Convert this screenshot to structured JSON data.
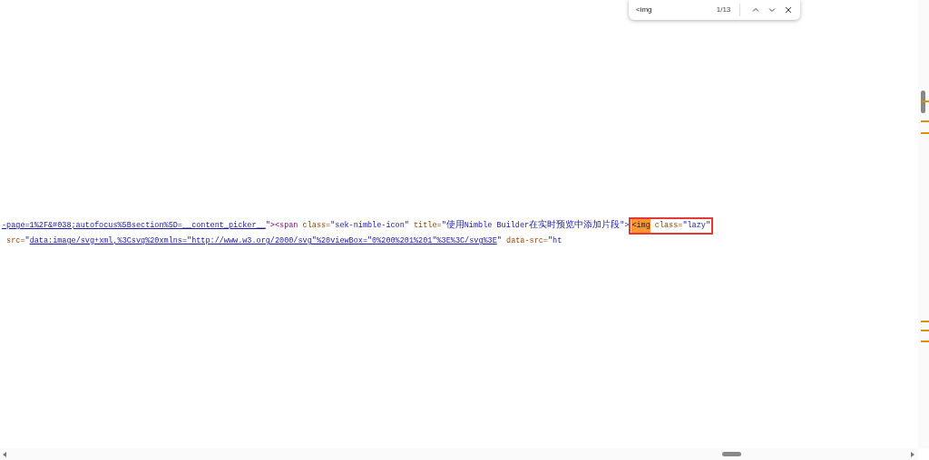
{
  "find_bar": {
    "query": "<img",
    "count": "1/13"
  },
  "source_line": {
    "before": [
      {
        "kind": "link",
        "text": "-page=1%2F&#038;autofocus%5Bsection%5D=__content_picker__"
      },
      {
        "kind": "value",
        "text": "\""
      },
      {
        "kind": "tag",
        "text": "><span"
      },
      {
        "kind": "attr",
        "text": "class="
      },
      {
        "kind": "value",
        "text": "\"sek-nimble-icon\""
      },
      {
        "kind": "attr",
        "text": "title="
      },
      {
        "kind": "value",
        "text": "\"使用Nimble Builder在实时预览中添加片段\""
      },
      {
        "kind": "tag",
        "text": ">"
      }
    ],
    "outlined": [
      {
        "kind": "match",
        "text": "<img",
        "selected": true
      },
      {
        "kind": "attr",
        "text": "class="
      },
      {
        "kind": "value",
        "text": "\"lazy\""
      }
    ],
    "after": [
      {
        "kind": "attr",
        "text": "src="
      },
      {
        "kind": "value",
        "text": "\""
      },
      {
        "kind": "link",
        "text": "data:image/svg+xml,%3Csvg%20xmlns=\"http://www.w3.org/2000/svg\"%20viewBox=\"0%200%201%201\"%3E%3C/svg%3E"
      },
      {
        "kind": "value",
        "text": "\""
      },
      {
        "kind": "attr",
        "text": "data-src="
      },
      {
        "kind": "value",
        "text": "\"ht"
      }
    ]
  }
}
